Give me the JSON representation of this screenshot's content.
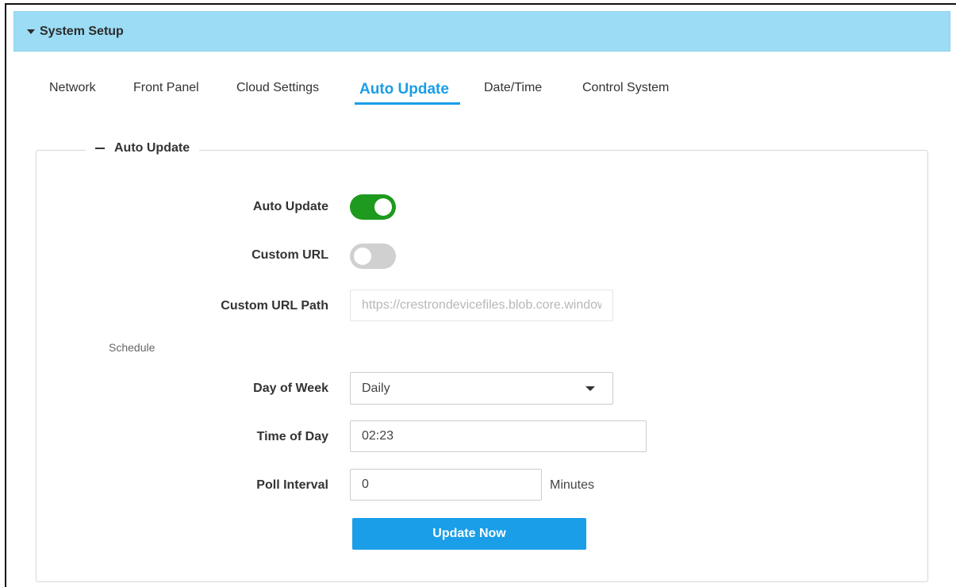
{
  "header": {
    "title": "System Setup",
    "icon": "caret-down-icon"
  },
  "tabs": [
    {
      "label": "Network",
      "active": false
    },
    {
      "label": "Front Panel",
      "active": false
    },
    {
      "label": "Cloud Settings",
      "active": false
    },
    {
      "label": "Auto Update",
      "active": true
    },
    {
      "label": "Date/Time",
      "active": false
    },
    {
      "label": "Control System",
      "active": false
    }
  ],
  "section": {
    "title": "Auto Update",
    "collapse_icon": "minus-icon"
  },
  "fields": {
    "auto_update": {
      "label": "Auto Update",
      "enabled": true
    },
    "custom_url": {
      "label": "Custom URL",
      "enabled": false
    },
    "custom_url_path": {
      "label": "Custom URL Path",
      "placeholder": "https://crestrondevicefiles.blob.core.windows.net/",
      "value": ""
    },
    "schedule_heading": "Schedule",
    "day_of_week": {
      "label": "Day of Week",
      "value": "Daily"
    },
    "time_of_day": {
      "label": "Time of Day",
      "value": "02:23"
    },
    "poll_interval": {
      "label": "Poll Interval",
      "value": "0",
      "units": "Minutes"
    }
  },
  "actions": {
    "update_now": "Update Now"
  },
  "colors": {
    "header_bg": "#9cdcf4",
    "accent": "#1a9ee8",
    "toggle_on": "#1e9a1e",
    "toggle_off": "#d0d0d0"
  }
}
